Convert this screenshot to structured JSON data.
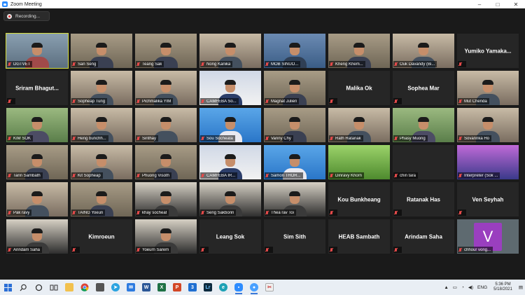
{
  "window": {
    "title": "Zoom Meeting",
    "controls": [
      "–",
      "□",
      "✕"
    ]
  },
  "recording": {
    "label": "Recording..."
  },
  "colors": {
    "active_speaker_border": "#d6dd3a",
    "muted_icon": "#e34a4a",
    "tile_bg": "#262626",
    "zoom_blue": "#2d8cff"
  },
  "participants": [
    {
      "name": "DGTVET",
      "video": true,
      "active": true,
      "scene": "flags"
    },
    {
      "name": "San Seng",
      "video": true,
      "scene": "office"
    },
    {
      "name": "Teang Sak",
      "video": true,
      "scene": "office"
    },
    {
      "name": "Nong Kanika",
      "video": true,
      "scene": "room"
    },
    {
      "name": "MOB SINUO...",
      "video": true,
      "scene": "banner"
    },
    {
      "name": "Kheng Khem...",
      "video": true,
      "scene": "office"
    },
    {
      "name": "Ouk Davandy (Bi...",
      "video": true,
      "scene": "room"
    },
    {
      "name": "Yumiko Yamaka...",
      "video": false
    },
    {
      "name": "Sriram Bhagut...",
      "video": false
    },
    {
      "name": "Sopheap Tung",
      "video": true,
      "scene": "room"
    },
    {
      "name": "Pichmalika YIM",
      "video": true,
      "scene": "room"
    },
    {
      "name": "CAMFEBA So...",
      "video": true,
      "scene": "logo"
    },
    {
      "name": "Magnat Julien",
      "video": true,
      "scene": "office"
    },
    {
      "name": "Malika Ok",
      "video": false
    },
    {
      "name": "Sophea Mar",
      "video": false
    },
    {
      "name": "Mut Chenda",
      "video": true,
      "scene": "room"
    },
    {
      "name": "KIM SOK",
      "video": true,
      "scene": "outdoor"
    },
    {
      "name": "Heng bunchh...",
      "video": true,
      "scene": "room"
    },
    {
      "name": "Sinthay",
      "video": true,
      "scene": "room"
    },
    {
      "name": "Sou Socheata",
      "video": true,
      "scene": "blue"
    },
    {
      "name": "Vanny Chy",
      "video": true,
      "scene": "office"
    },
    {
      "name": "Rath Ratanak",
      "video": true,
      "scene": "room"
    },
    {
      "name": "Phasy Muong",
      "video": true,
      "scene": "outdoor"
    },
    {
      "name": "Sovannka Ho",
      "video": true,
      "scene": "room"
    },
    {
      "name": "Tann Sambath",
      "video": true,
      "scene": "office"
    },
    {
      "name": "Kit Sopheap",
      "video": true,
      "scene": "room"
    },
    {
      "name": "Phuong Visoth",
      "video": true,
      "scene": "office"
    },
    {
      "name": "CAMFEBA IR...",
      "video": true,
      "scene": "logo"
    },
    {
      "name": "Samon THOR...",
      "video": true,
      "scene": "blue"
    },
    {
      "name": "Dinravy Khorn",
      "video": true,
      "scene": "green"
    },
    {
      "name": "chin tara",
      "video": false,
      "muted_only": true
    },
    {
      "name": "Interpreter (Sok ...",
      "video": true,
      "scene": "abstract"
    },
    {
      "name": "Pak ravy",
      "video": true,
      "scene": "room"
    },
    {
      "name": "TAING Yoeun",
      "video": true,
      "scene": "office"
    },
    {
      "name": "khay socheat",
      "video": true,
      "scene": "photo"
    },
    {
      "name": "Seng Sakborin",
      "video": true,
      "scene": "photo"
    },
    {
      "name": "Thea rav Toi",
      "video": true,
      "scene": "photo"
    },
    {
      "name": "Kou Bunkheang",
      "video": false
    },
    {
      "name": "Ratanak Has",
      "video": false
    },
    {
      "name": "Ven Seyhah",
      "video": false
    },
    {
      "name": "Arindam Saha",
      "video": true,
      "scene": "photo"
    },
    {
      "name": "Kimroeun",
      "video": false
    },
    {
      "name": "Yoeurn Sarem",
      "video": true,
      "scene": "photo"
    },
    {
      "name": "Leang Sok",
      "video": false
    },
    {
      "name": "Sim Sith",
      "video": false
    },
    {
      "name": "HEAB Sambath",
      "video": false
    },
    {
      "name": "Arindam Saha",
      "video": false
    },
    {
      "name": "chhour vong...",
      "video": true,
      "scene": "letter",
      "letter": "V"
    }
  ],
  "taskbar": {
    "icons": [
      "windows-start",
      "search",
      "cortana",
      "task-view",
      "file-explorer",
      "chrome",
      "store",
      "telegram",
      "mail",
      "word",
      "excel",
      "powerpoint",
      "app-3",
      "lightroom",
      "edge",
      "zoom",
      "zoom-chat",
      "snip-tool"
    ],
    "language": "ENG",
    "time": "5:36 PM",
    "date": "5/18/2021"
  }
}
